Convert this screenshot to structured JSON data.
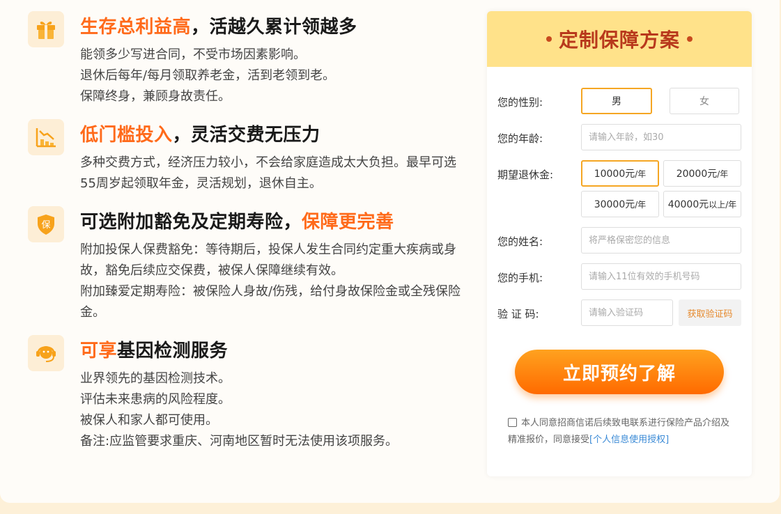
{
  "features": [
    {
      "icon": "gift-icon",
      "title_hl": "生存总利益高",
      "title_rest": "，活越久累计领越多",
      "lines": [
        "能领多少写进合同，不受市场因素影响。",
        "退休后每年/每月领取养老金，活到老领到老。",
        "保障终身，兼顾身故责任。"
      ]
    },
    {
      "icon": "chart-down-icon",
      "title_hl": "低门槛投入",
      "title_rest": "，灵活交费无压力",
      "lines": [
        "多种交费方式，经济压力较小，不会给家庭造成太大负担。最早可选55周岁起领取年金，灵活规划，退休自主。"
      ]
    },
    {
      "icon": "shield-icon",
      "icon_text": "保",
      "title_pre": "可选附加豁免及定期寿险，",
      "title_hl": "保障更完善",
      "lines": [
        "附加投保人保费豁免：等待期后，投保人发生合同约定重大疾病或身故，豁免后续应交保费，被保人保障继续有效。",
        "附加臻爱定期寿险：被保险人身故/伤残，给付身故保险金或全残保险金。"
      ]
    },
    {
      "icon": "headset-icon",
      "title_hl": "可享",
      "title_rest": "基因检测服务",
      "lines": [
        "业界领先的基因检测技术。",
        "评估未来患病的风险程度。",
        "被保人和家人都可使用。",
        "备注:应监管要求重庆、河南地区暂时无法使用该项服务。"
      ]
    }
  ],
  "form": {
    "title": "定制保障方案",
    "gender_label": "您的性别:",
    "gender_male": "男",
    "gender_female": "女",
    "age_label": "您的年龄:",
    "age_placeholder": "请输入年龄，如30",
    "pension_label": "期望退休金:",
    "pension_options": [
      {
        "amount": "10000元",
        "unit": "/年",
        "selected": true
      },
      {
        "amount": "20000元",
        "unit": "/年",
        "selected": false
      },
      {
        "amount": "30000元",
        "unit": "/年",
        "selected": false
      },
      {
        "amount": "40000元",
        "unit": "以上/年",
        "selected": false
      }
    ],
    "name_label": "您的姓名:",
    "name_placeholder": "将严格保密您的信息",
    "phone_label": "您的手机:",
    "phone_placeholder": "请输入11位有效的手机号码",
    "code_label": "验 证 码:",
    "code_placeholder": "请输入验证码",
    "get_code": "获取验证码",
    "submit": "立即预约了解",
    "agree_text": "本人同意招商信诺后续致电联系进行保险产品介绍及精准报价，同意接受",
    "agree_link": "[个人信息使用授权]"
  },
  "colors": {
    "accent": "#ff6a1a",
    "header_bg": "#ffe28a",
    "title_color": "#b8391c"
  }
}
